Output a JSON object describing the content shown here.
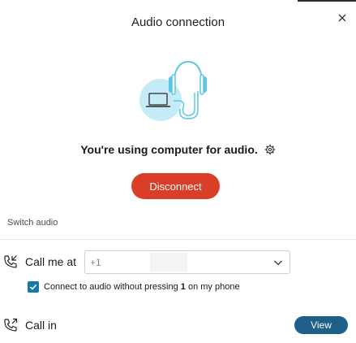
{
  "dialog": {
    "title": "Audio connection",
    "close_icon": "close-icon"
  },
  "illustration": {
    "icon": "headset-laptop-illustration",
    "colors": {
      "accent": "#5bc6e6",
      "circle": "#c5ebf6"
    }
  },
  "status": {
    "text": "You're using computer for audio.",
    "settings_icon": "gear-icon"
  },
  "actions": {
    "disconnect_label": "Disconnect",
    "disconnect_color": "#d93f28"
  },
  "switch_audio": {
    "section_label": "Switch audio",
    "call_me": {
      "label": "Call me at",
      "icon": "phone-callback-icon",
      "country_code": "+1",
      "number": ""
    },
    "auto_connect": {
      "checked": true,
      "text_before": "Connect to audio without pressing ",
      "key": "1",
      "text_after": " on my phone"
    },
    "call_in": {
      "label": "Call in",
      "icon": "phone-outgoing-icon",
      "view_label": "View",
      "view_color": "#1d5f86"
    }
  }
}
